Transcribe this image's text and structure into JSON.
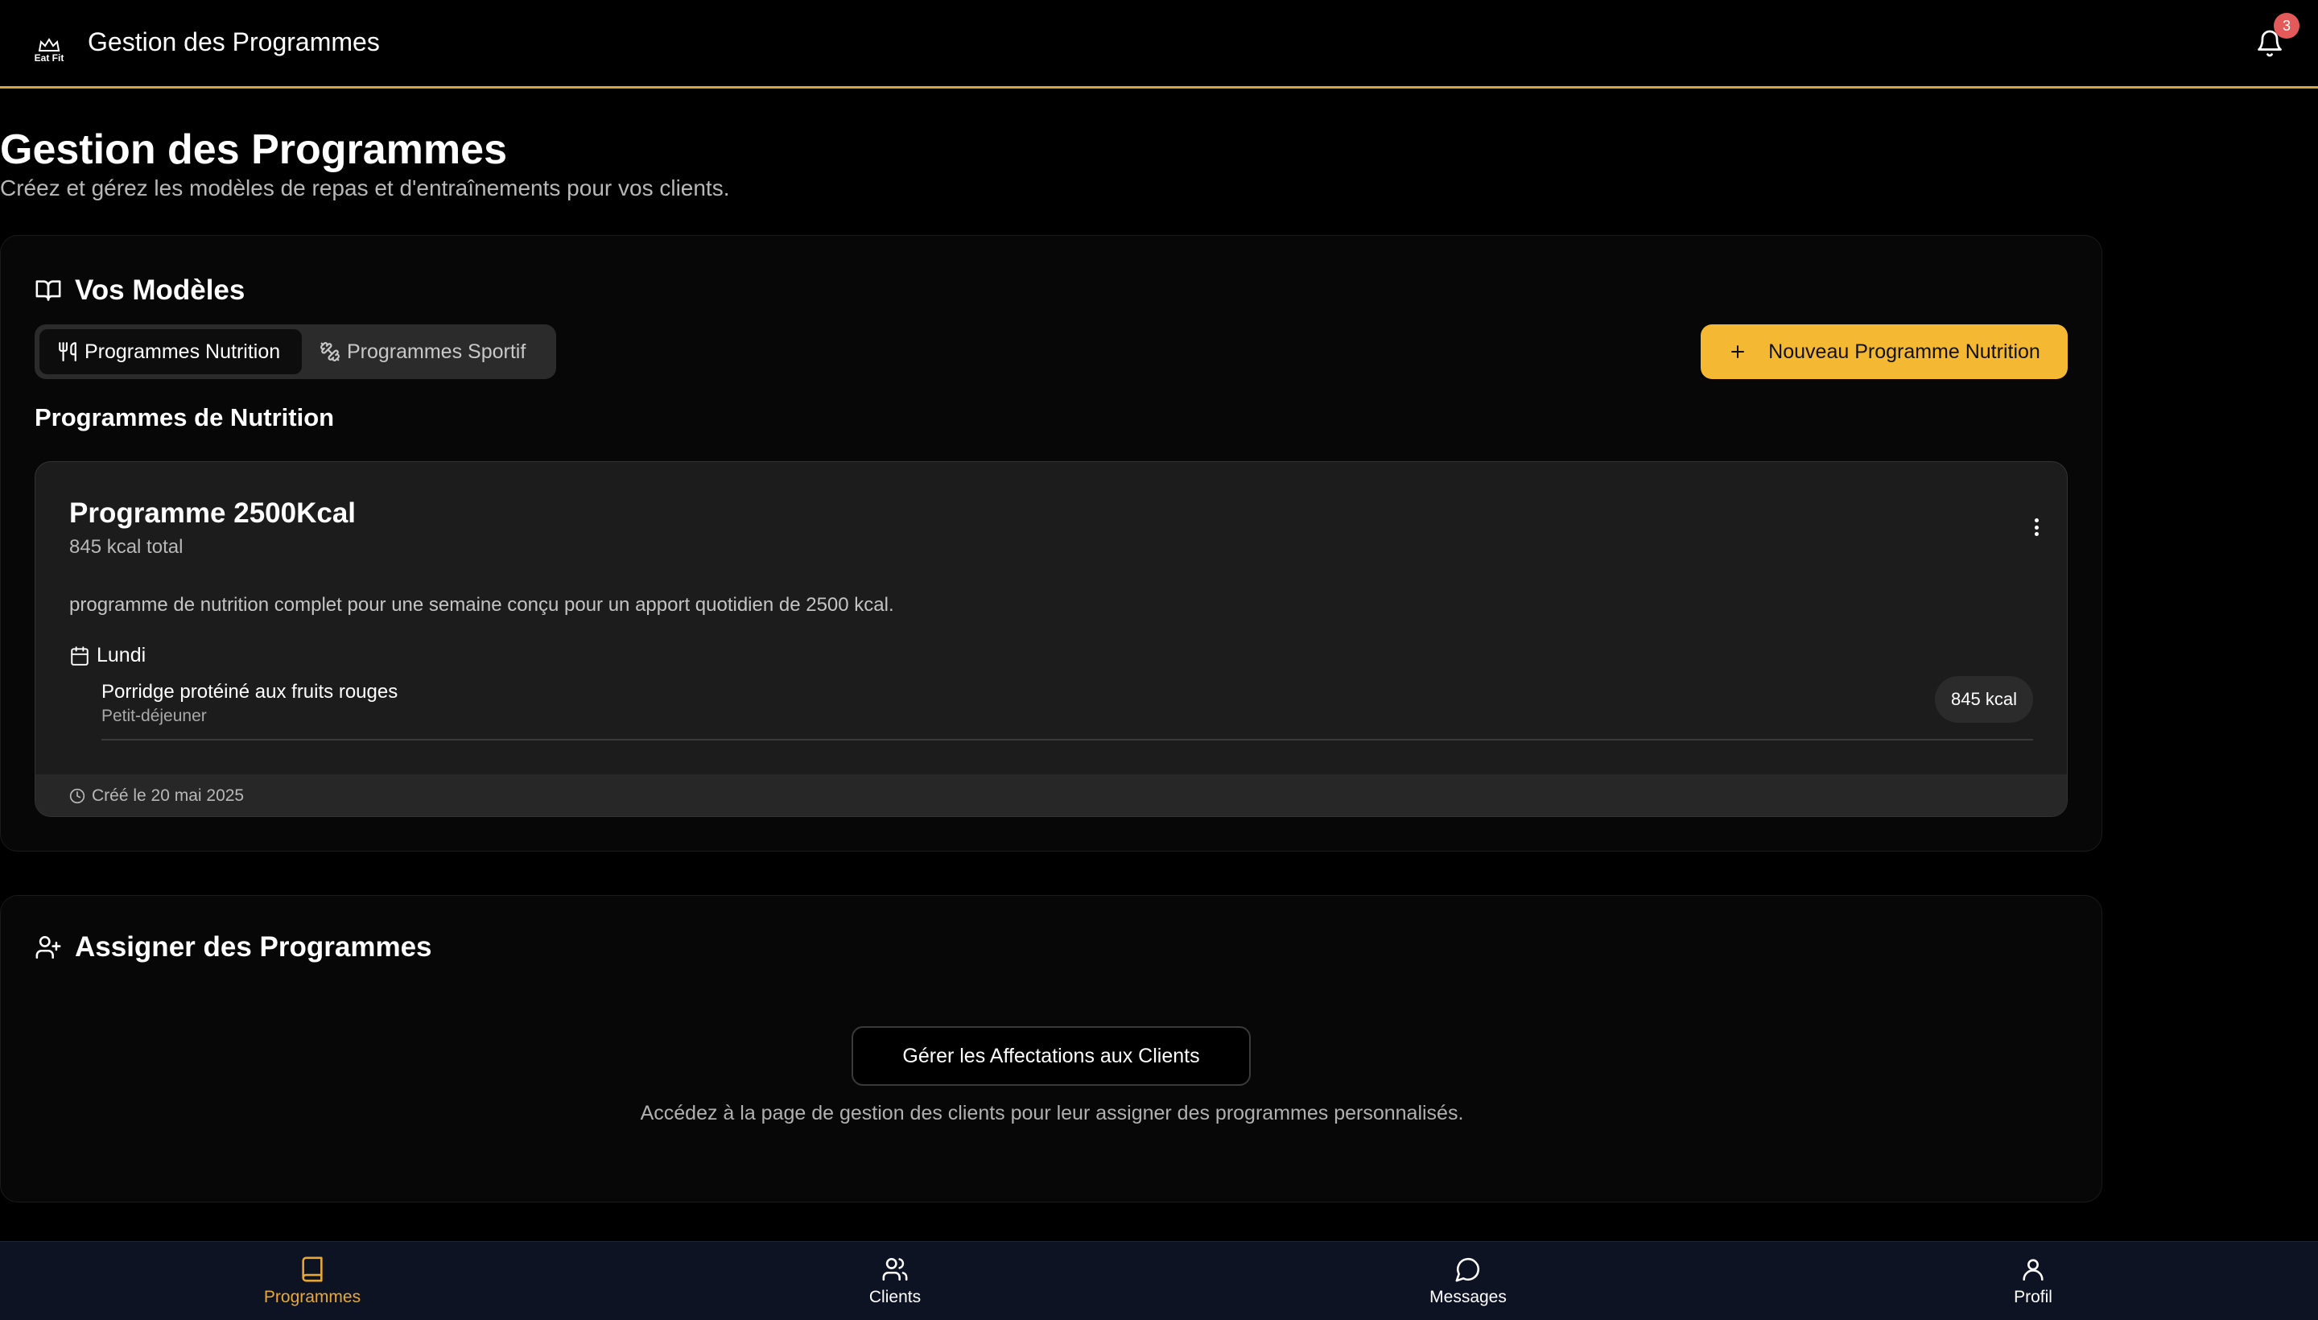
{
  "header": {
    "logo_text": "Eat Fit",
    "app_title": "Gestion des Programmes",
    "notification_count": "3"
  },
  "page": {
    "title": "Gestion des Programmes",
    "subtitle": "Créez et gérez les modèles de repas et d'entraînements pour vos clients."
  },
  "models": {
    "section_title": "Vos Modèles",
    "tabs": [
      {
        "label": "Programmes Nutrition",
        "icon": "utensils-icon",
        "active": true
      },
      {
        "label": "Programmes Sportif",
        "icon": "dumbbell-icon",
        "active": false
      }
    ],
    "new_button_label": "Nouveau Programme Nutrition",
    "subsection_title": "Programmes de Nutrition",
    "program": {
      "title": "Programme 2500Kcal",
      "total_kcal": "845 kcal total",
      "description": "programme de nutrition complet pour une semaine conçu pour un apport quotidien de 2500 kcal.",
      "day": "Lundi",
      "meal": {
        "name": "Porridge protéiné aux fruits rouges",
        "type": "Petit-déjeuner",
        "kcal": "845 kcal"
      },
      "created": "Créé le 20 mai 2025"
    }
  },
  "assign": {
    "section_title": "Assigner des Programmes",
    "button_label": "Gérer les Affectations aux Clients",
    "description": "Accédez à la page de gestion des clients pour leur assigner des programmes personnalisés."
  },
  "bottom_nav": [
    {
      "label": "Programmes",
      "icon": "book-icon",
      "active": true
    },
    {
      "label": "Clients",
      "icon": "users-icon",
      "active": false
    },
    {
      "label": "Messages",
      "icon": "message-icon",
      "active": false
    },
    {
      "label": "Profil",
      "icon": "user-icon",
      "active": false
    }
  ],
  "colors": {
    "accent": "#f5b833",
    "header_border": "#d9a43b",
    "badge": "#e45a5a",
    "nav_bg": "#0d1323"
  }
}
